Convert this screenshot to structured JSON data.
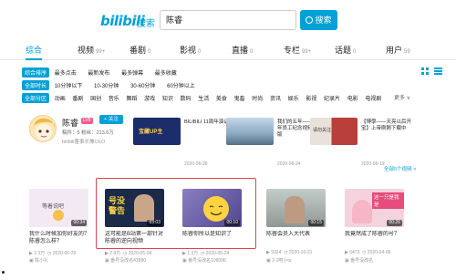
{
  "header": {
    "logo": "bilibili",
    "logo_sub": "搜索",
    "query": "陈睿",
    "search_button": "搜索"
  },
  "tabs": [
    {
      "label": "综合",
      "count": ""
    },
    {
      "label": "视频",
      "count": "99+"
    },
    {
      "label": "番剧",
      "count": "0"
    },
    {
      "label": "影视",
      "count": "0"
    },
    {
      "label": "直播",
      "count": "0"
    },
    {
      "label": "专栏",
      "count": "99+"
    },
    {
      "label": "话题",
      "count": "0"
    },
    {
      "label": "用户",
      "count": "59"
    }
  ],
  "filters": {
    "sort": {
      "badge": "综合排序",
      "options": [
        "最多点击",
        "最新发布",
        "最多弹幕",
        "最多收藏"
      ]
    },
    "duration": {
      "badge": "全部时长",
      "options": [
        "10分钟以下",
        "10-30分钟",
        "30-60分钟",
        "60分钟以上"
      ]
    },
    "zone": {
      "badge": "全部分区",
      "options": [
        "动画",
        "番剧",
        "国创",
        "音乐",
        "舞蹈",
        "游戏",
        "知识",
        "数码",
        "生活",
        "美食",
        "鬼畜",
        "时尚",
        "资讯",
        "娱乐",
        "影视",
        "纪录片",
        "电影",
        "电视剧"
      ],
      "more": "更多 ∨"
    }
  },
  "user": {
    "name": "陈睿",
    "level": "LV6",
    "follow": "+ 关注",
    "stats": "稿件：5   粉丝：213.6万",
    "desc": "bilibili董事长兼CEO",
    "videos": [
      {
        "title": "BILIBILI 11周年演讲",
        "date": "2020-06-26",
        "thumb_color": "#1b2d6b",
        "thumb_text": "宝藏UP主"
      },
      {
        "title": "我们的五年——B站五年员工纪念视频 2020版",
        "date": "2020-06-24",
        "thumb_color": "#8aa7c2",
        "thumb_text": ""
      },
      {
        "title": "【博學——天亮以后开宝】上帝刚刚下载中",
        "date": "2020-06-19",
        "thumb_color": "#b9403a",
        "thumb_text": "请勿关注"
      }
    ],
    "all_videos": "全部5个视频 >"
  },
  "videos": [
    {
      "title": "我什么时候加你好友的？陈睿怎么样？",
      "duration": "00:34",
      "views": "2.3万",
      "date": "2020-06-29",
      "uploader": "陈小礼",
      "thumb_color": "#f3e9f5",
      "thumb_text": "等着说吧"
    },
    {
      "title": "这可能是B站第一部针对陈睿的逆向视频",
      "duration": "03:03",
      "views": "2.9万",
      "date": "2020-05-04",
      "uploader": "番号没改名43980",
      "thumb_color": "#1c2a4a",
      "thumb_text": "号没警告"
    },
    {
      "title": "陈睿你所以是知识了",
      "duration": "00:10",
      "views": "1.3万",
      "date": "2020-05-24",
      "uploader": "番号没改名109096",
      "thumb_color": "#6b5fa0",
      "thumb_text": ""
    },
    {
      "title": "陈睿会员入大代表",
      "duration": "00:15",
      "views": "9324",
      "date": "2020-10-21",
      "uploader": "2-1吧小tu",
      "thumb_color": "#9ea7a4",
      "thumb_text": ""
    },
    {
      "title": "我竟然成了陈睿的号？",
      "duration": "00:26",
      "views": "6473",
      "date": "2020-04-06",
      "uploader": "番号没改名",
      "thumb_color": "#f4d2de",
      "thumb_text": "这一只是我是"
    }
  ]
}
